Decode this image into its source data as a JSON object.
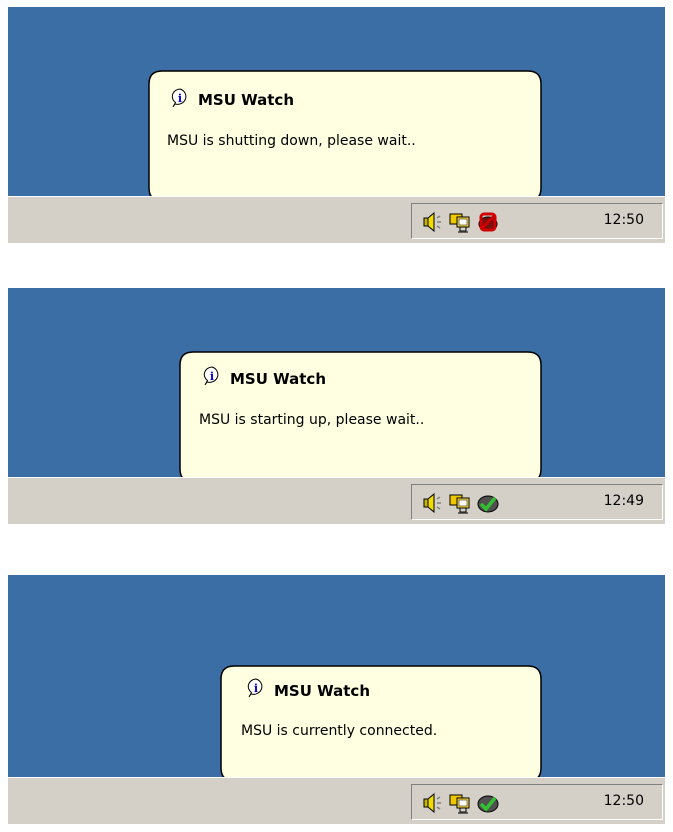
{
  "colors": {
    "desktop": "#3a6ea5",
    "taskbar": "#d4d0c8",
    "balloon_fill": "#ffffe1"
  },
  "panels": [
    {
      "balloon": {
        "title": "MSU Watch",
        "message": "MSU is shutting down, please wait.."
      },
      "tray_icons": [
        "speaker-icon",
        "network-monitor-icon",
        "msu-shutting-down-icon"
      ],
      "clock": "12:50"
    },
    {
      "balloon": {
        "title": "MSU Watch",
        "message": "MSU is starting up, please wait.."
      },
      "tray_icons": [
        "speaker-icon",
        "network-monitor-icon",
        "msu-starting-icon"
      ],
      "clock": "12:49"
    },
    {
      "balloon": {
        "title": "MSU Watch",
        "message": "MSU is currently connected."
      },
      "tray_icons": [
        "speaker-icon",
        "network-monitor-icon",
        "msu-connected-icon"
      ],
      "clock": "12:50"
    }
  ]
}
